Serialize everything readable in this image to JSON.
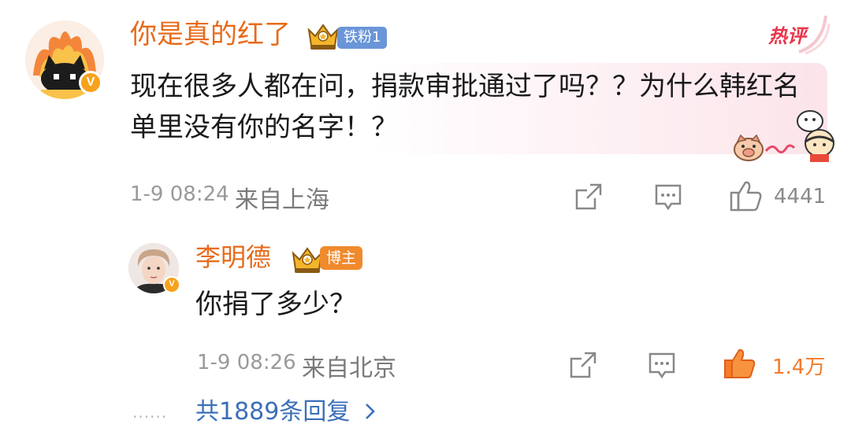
{
  "colors": {
    "username": "#e86a1a",
    "hot": "#e8354a",
    "link": "#3c6fb8",
    "liked": "#f47b2a",
    "fan_badge": "#6a95d8",
    "blogger_badge": "#f08a2c"
  },
  "comment": {
    "username": "你是真的红了",
    "fan_badge": "铁粉1",
    "hot_tag": "热评",
    "text": "现在很多人都在问，捐款审批通过了吗？？为什么韩红名单里没有你的名字！？",
    "time": "1-9 08:24",
    "location": "来自上海",
    "like_count": "4441",
    "icons": [
      "share-icon",
      "comment-icon",
      "like-icon"
    ]
  },
  "reply": {
    "username": "李明德",
    "badge": "博主",
    "text": "你捐了多少？",
    "time": "1-9 08:26",
    "location": "来自北京",
    "like_count": "1.4万",
    "liked": true,
    "icons": [
      "share-icon",
      "comment-icon",
      "like-icon-filled"
    ]
  },
  "more": {
    "dots": "......",
    "label": "共1889条回复"
  }
}
